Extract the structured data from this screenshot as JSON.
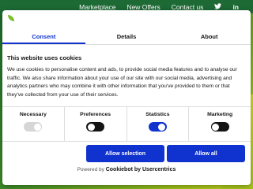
{
  "topnav": {
    "links": [
      "Marketplace",
      "New Offers",
      "Contact us"
    ],
    "social": [
      "twitter",
      "in"
    ]
  },
  "dialog": {
    "tabs": [
      {
        "label": "Consent",
        "active": true
      },
      {
        "label": "Details",
        "active": false
      },
      {
        "label": "About",
        "active": false
      }
    ],
    "heading": "This website uses cookies",
    "body": "We use cookies to personalise content and ads, to provide social media features and to analyse our traffic. We also share information about your use of our site with our social media, advertising and analytics partners who may combine it with other information that you've provided to them or that they've collected from your use of their services.",
    "preferences": [
      {
        "label": "Necessary",
        "state": "disabled-on"
      },
      {
        "label": "Preferences",
        "state": "off"
      },
      {
        "label": "Statistics",
        "state": "on"
      },
      {
        "label": "Marketing",
        "state": "off"
      }
    ],
    "buttons": {
      "allow_selection": "Allow selection",
      "allow_all": "Allow all"
    },
    "powered_by_prefix": "Powered by ",
    "powered_by_brand": "Cookiebot by Usercentrics"
  },
  "colors": {
    "accent": "#1032cf",
    "topbar": "#1d6a35"
  }
}
